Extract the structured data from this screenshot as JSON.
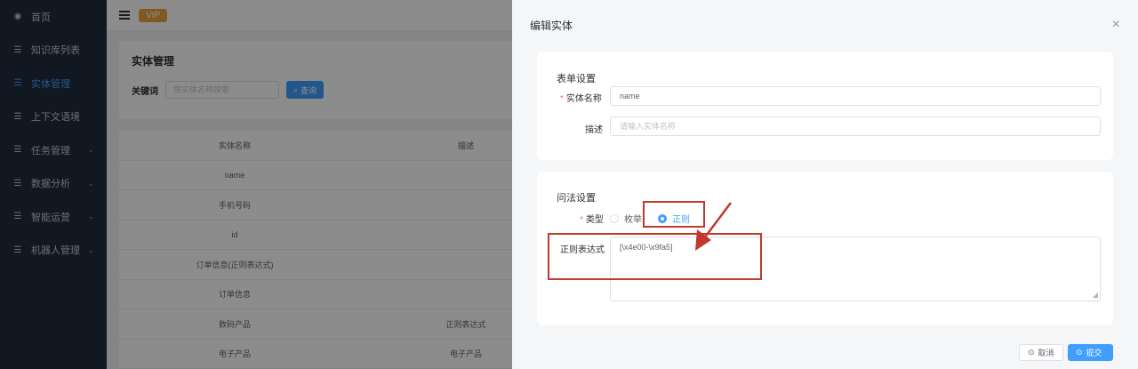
{
  "sidebar": {
    "items": [
      {
        "label": "首页",
        "icon": "dashboard-icon",
        "glyph": "◉"
      },
      {
        "label": "知识库列表",
        "icon": "list-icon",
        "glyph": "☰"
      },
      {
        "label": "实体管理",
        "icon": "list-icon",
        "glyph": "☰"
      },
      {
        "label": "上下文语境",
        "icon": "list-icon",
        "glyph": "☰"
      },
      {
        "label": "任务管理",
        "icon": "list-icon",
        "glyph": "☰",
        "arrow": "⌄"
      },
      {
        "label": "数据分析",
        "icon": "list-icon",
        "glyph": "☰",
        "arrow": "⌄"
      },
      {
        "label": "智能运营",
        "icon": "list-icon",
        "glyph": "☰",
        "arrow": "⌄"
      },
      {
        "label": "机器人管理",
        "icon": "list-icon",
        "glyph": "☰",
        "arrow": "⌄"
      }
    ]
  },
  "header": {
    "badge": "VIP"
  },
  "search": {
    "title": "实体管理",
    "keyword_label": "关键词",
    "placeholder": "搜实体名称搜索",
    "button": "查询",
    "button_icon": "⌕"
  },
  "table": {
    "headers": [
      "实体名称",
      "描述"
    ],
    "rows": [
      [
        "name",
        ""
      ],
      [
        "手机号码",
        ""
      ],
      [
        "id",
        ""
      ],
      [
        "订单信息(正则表达式)",
        ""
      ],
      [
        "订单信息",
        ""
      ],
      [
        "数码产品",
        "正则表达式"
      ],
      [
        "电子产品",
        "电子产品"
      ]
    ]
  },
  "drawer": {
    "title": "编辑实体",
    "close": "×",
    "form_section": {
      "title": "表单设置",
      "name_label": "实体名称",
      "name_value": "name",
      "desc_label": "描述",
      "desc_placeholder": "请输入实体名称"
    },
    "lexicon_section": {
      "title": "问法设置",
      "type_label": "类型",
      "options": [
        "枚举",
        "正则"
      ],
      "selected": "正则",
      "regex_label": "正则表达式",
      "regex_value": "[\\x4e00-\\x9fa5]",
      "resize_glyph": "◢"
    },
    "cancel": "取消",
    "cancel_icon": "⊙",
    "submit": "提交",
    "submit_icon": "⊙"
  },
  "colors": {
    "primary": "#409eff",
    "sidebar_bg": "#1f2d3d",
    "annotation": "#c0392b",
    "vip": "#e6a23c"
  }
}
